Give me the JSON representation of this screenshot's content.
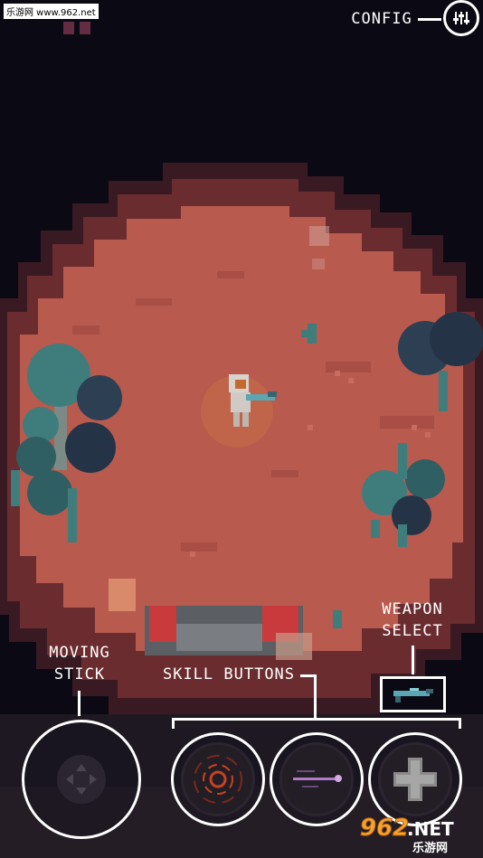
{
  "watermark": {
    "text": "乐游网 www.962.net"
  },
  "hud": {
    "config_label": "CONFIG",
    "config_icon": "sliders-icon",
    "moving_stick_label": "MOVING\nSTICK",
    "skill_buttons_label": "SKILL BUTTONS",
    "weapon_select_label": "WEAPON\nSELECT",
    "weapon_icon": "blaster-rifle-icon"
  },
  "skills": [
    {
      "name": "vortex-skill",
      "icon": "vortex-icon",
      "accent": "#c8431f"
    },
    {
      "name": "beam-skill",
      "icon": "laser-beam-icon",
      "accent": "#b07ac8"
    },
    {
      "name": "heal-skill",
      "icon": "plus-cross-icon",
      "accent": "#8a8a8a"
    }
  ],
  "logo": {
    "digits": "962",
    "suffix": ".NET",
    "subtitle": "乐游网"
  },
  "colors": {
    "ground": "#b85a4e",
    "ground_dark": "#8f3f38",
    "cliff": "#4a2127",
    "tree": "#2f5f63",
    "tree_light": "#3f7d7c",
    "hud_line": "#ffffff"
  }
}
